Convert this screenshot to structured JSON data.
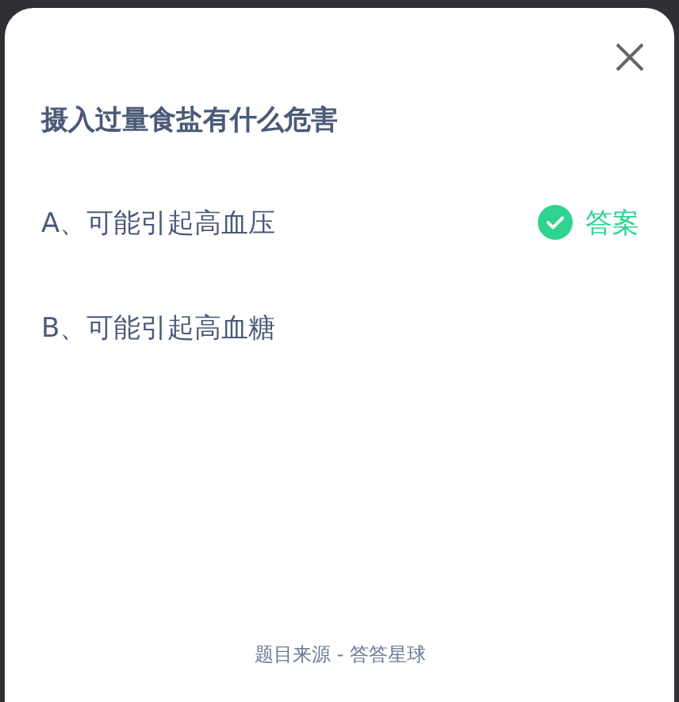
{
  "question": "摄入过量食盐有什么危害",
  "options": [
    {
      "text": "A、可能引起高血压",
      "correct": true
    },
    {
      "text": "B、可能引起高血糖",
      "correct": false
    }
  ],
  "answer_label": "答案",
  "source": "题目来源 - 答答星球"
}
